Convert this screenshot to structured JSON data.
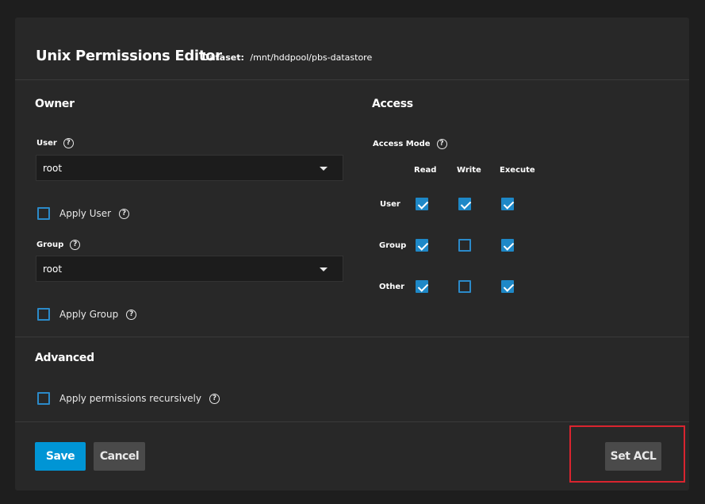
{
  "header": {
    "title": "Unix Permissions Editor",
    "dataset_label": "Dataset:",
    "dataset_path": "/mnt/hddpool/pbs-datastore"
  },
  "owner": {
    "section_title": "Owner",
    "user_label": "User",
    "user_value": "root",
    "apply_user_label": "Apply User",
    "apply_user_checked": false,
    "group_label": "Group",
    "group_value": "root",
    "apply_group_label": "Apply Group",
    "apply_group_checked": false
  },
  "access": {
    "section_title": "Access",
    "mode_label": "Access Mode",
    "columns": [
      "Read",
      "Write",
      "Execute"
    ],
    "rows": [
      {
        "label": "User",
        "read": true,
        "write": true,
        "execute": true
      },
      {
        "label": "Group",
        "read": true,
        "write": false,
        "execute": true
      },
      {
        "label": "Other",
        "read": true,
        "write": false,
        "execute": true
      }
    ]
  },
  "advanced": {
    "section_title": "Advanced",
    "recursive_label": "Apply permissions recursively",
    "recursive_checked": false
  },
  "actions": {
    "save_label": "Save",
    "cancel_label": "Cancel",
    "set_acl_label": "Set ACL"
  },
  "colors": {
    "accent": "#0095d5",
    "highlight": "#d9242f"
  },
  "icons": {
    "help": "help-circle-icon",
    "dropdown": "chevron-down-icon",
    "check": "check-icon"
  }
}
